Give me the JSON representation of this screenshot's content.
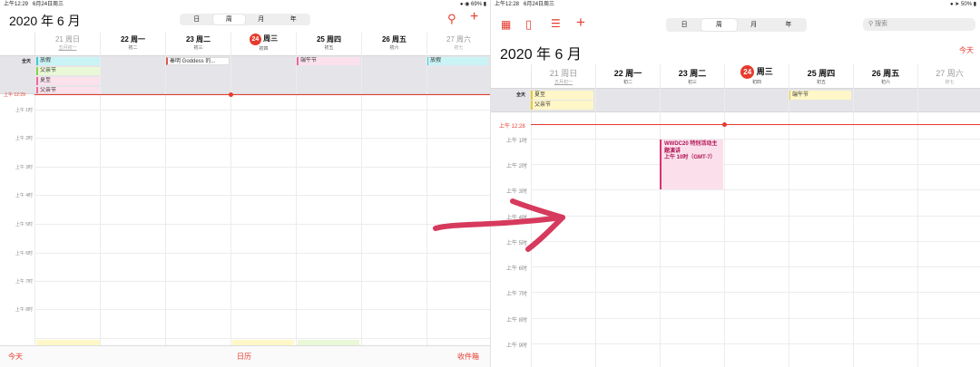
{
  "left": {
    "status": {
      "time": "上午12:29",
      "date": "6月24日周三",
      "battery": "69%"
    },
    "view_tabs": [
      "日",
      "周",
      "月",
      "年"
    ],
    "selected_view": "周",
    "title": "2020 年 6 月",
    "days": [
      {
        "name": "21 周日",
        "lunar": "五月初一"
      },
      {
        "name": "22 周一",
        "lunar": "初二"
      },
      {
        "name": "23 周二",
        "lunar": "初三"
      },
      {
        "num": "24",
        "name": "周三",
        "lunar": "初四"
      },
      {
        "name": "25 周四",
        "lunar": "初五"
      },
      {
        "name": "26 周五",
        "lunar": "初六"
      },
      {
        "name": "27 周六",
        "lunar": "初七"
      }
    ],
    "allday_label": "全天",
    "allday_events": [
      {
        "text": "放假",
        "color": "cyan"
      },
      {
        "text": "父亲节",
        "color": "green"
      },
      {
        "text": "夏至",
        "color": "pink"
      },
      {
        "text": "父亲节",
        "color": "pink"
      },
      {
        "text": "秦明 Goddess 的...",
        "color": "white"
      },
      {
        "text": "端午节",
        "color": "pink"
      },
      {
        "text": "放假",
        "color": "cyan"
      }
    ],
    "now_label": "上午 12:29",
    "hours": [
      "上午 1时",
      "上午 2时",
      "上午 3时",
      "上午 4时",
      "上午 5时",
      "上午 6时",
      "上午 7时",
      "上午 8时"
    ],
    "tabbar": {
      "today": "今天",
      "calendars": "日历",
      "inbox": "收件箱"
    }
  },
  "right": {
    "status": {
      "time": "上午12:28",
      "date": "6月24日周三",
      "battery": "50%"
    },
    "view_tabs": [
      "日",
      "周",
      "月",
      "年"
    ],
    "selected_view": "周",
    "search_placeholder": "搜索",
    "title": "2020 年 6 月",
    "today_button": "今天",
    "days": [
      {
        "name": "21 周日",
        "lunar": "五月初一"
      },
      {
        "name": "22 周一",
        "lunar": "初二"
      },
      {
        "name": "23 周二",
        "lunar": "初三"
      },
      {
        "num": "24",
        "name": "周三",
        "lunar": "初四"
      },
      {
        "name": "25 周四",
        "lunar": "初五"
      },
      {
        "name": "26 周五",
        "lunar": "初六"
      },
      {
        "name": "27 周六",
        "lunar": "初七"
      }
    ],
    "allday_label": "全天",
    "allday_events": [
      {
        "text": "夏至",
        "color": "yellow"
      },
      {
        "text": "父亲节",
        "color": "yellow"
      },
      {
        "text": "端午节",
        "color": "yellow"
      }
    ],
    "now_label": "上午 12:28",
    "hours": [
      "上午 1时",
      "上午 2时",
      "上午 3时",
      "上午 4时",
      "上午 5时",
      "上午 6时",
      "上午 7时",
      "上午 8时",
      "上午 9时"
    ],
    "event": {
      "title": "WWDC20 特别活动主题演讲",
      "time": "上午 10时（GMT-7）"
    }
  },
  "arrow_color": "#d63a5c",
  "accent": "#e63b2e"
}
